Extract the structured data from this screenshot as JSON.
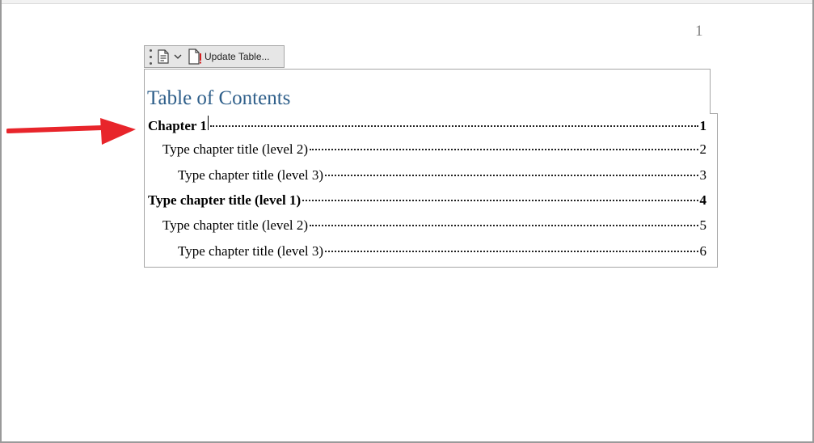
{
  "header": {
    "page_number": "1"
  },
  "toc_toolbar": {
    "update_label": "Update Table..."
  },
  "toc": {
    "title": "Table of Contents",
    "entries": [
      {
        "text": "Chapter 1",
        "page": "1",
        "level": 1
      },
      {
        "text": "Type chapter title (level 2)",
        "page": "2",
        "level": 2
      },
      {
        "text": "Type chapter title (level 3)",
        "page": "3",
        "level": 3
      },
      {
        "text": "Type chapter title (level 1)",
        "page": "4",
        "level": 1
      },
      {
        "text": "Type chapter title (level 2)",
        "page": "5",
        "level": 2
      },
      {
        "text": "Type chapter title (level 3)",
        "page": "6",
        "level": 3
      }
    ]
  },
  "colors": {
    "title": "#2f5f8a",
    "arrow": "#e8252b",
    "toolbar_bg": "#e6e6e6"
  }
}
